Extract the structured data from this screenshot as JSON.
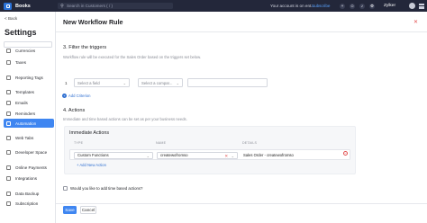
{
  "topbar": {
    "app_name": "Books",
    "search_placeholder": "Search in Customers ( / )",
    "trial_text": "Your account is on ent...",
    "subscribe_label": "Subscribe",
    "org_name": "Zylker",
    "accent": "#23273a"
  },
  "sidebar": {
    "back_label": "< Back",
    "title": "Settings",
    "items": [
      {
        "label": "Currencies"
      },
      {
        "label": "Taxes"
      },
      {
        "label": "Reporting Tags"
      },
      {
        "label": "Templates"
      },
      {
        "label": "Emails"
      },
      {
        "label": "Reminders"
      },
      {
        "label": "Automation",
        "active": true
      },
      {
        "label": "Web Tabs"
      },
      {
        "label": "Developer Space"
      },
      {
        "label": "Online Payments"
      },
      {
        "label": "Integrations"
      },
      {
        "label": "Data Backup"
      },
      {
        "label": "Subscription"
      }
    ],
    "active_color": "#3f86f1"
  },
  "main": {
    "title": "New Workflow Rule",
    "close_icon": "close-icon",
    "triggers": {
      "heading": "3. Filter the triggers",
      "description": "Workflow rule will be executed for the Sales Order based on the triggers set below.",
      "criteria_number": "1",
      "field_placeholder": "Select a field",
      "comparator_placeholder": "Select a compar...",
      "add_criterion_label": "Add Criterion"
    },
    "actions": {
      "heading": "4. Actions",
      "description": "Immediate and time based actions can be set as per your business needs.",
      "box_title": "Immediate Actions",
      "col_type": "TYPE",
      "col_name": "NAME",
      "col_details": "DETAILS",
      "row": {
        "type": "Custom Functions",
        "name": "createwofromso",
        "details": "Sales Order - createwofromso"
      },
      "add_action_label": "+ Add New Action"
    },
    "time_based_label": "Would you like to add time based actions?",
    "save_label": "Save",
    "cancel_label": "Cancel"
  }
}
